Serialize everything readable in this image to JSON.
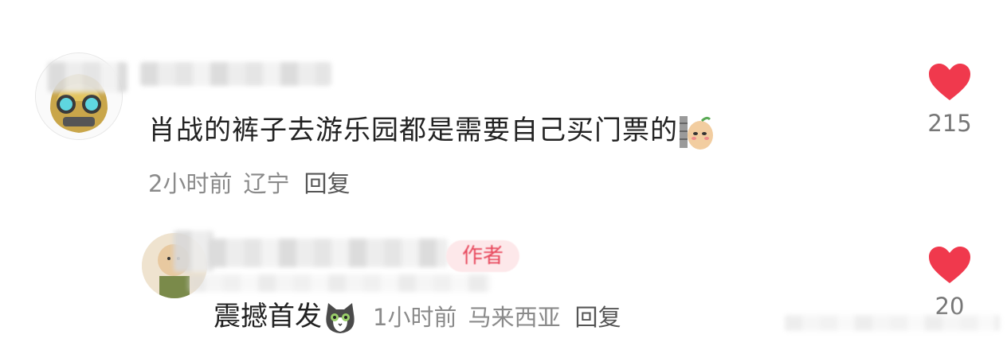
{
  "comment": {
    "text": "肖战的裤子去游乐园都是需要自己买门票的",
    "time": "2小时前",
    "location": "辽宁",
    "reply_label": "回复",
    "like_count": "215"
  },
  "reply": {
    "text": "震撼首发",
    "time": "1小时前",
    "location": "马来西亚",
    "reply_label": "回复",
    "badge": "作者",
    "like_count": "20"
  },
  "colors": {
    "heart": "#f0394d",
    "badge_bg": "#fde8ea",
    "badge_text": "#e8485c",
    "meta_text": "#8a8a8a"
  },
  "icons": {
    "like": "heart-icon",
    "comment_emoji": "potato-sticker-icon",
    "reply_emoji": "cat-face-icon"
  }
}
